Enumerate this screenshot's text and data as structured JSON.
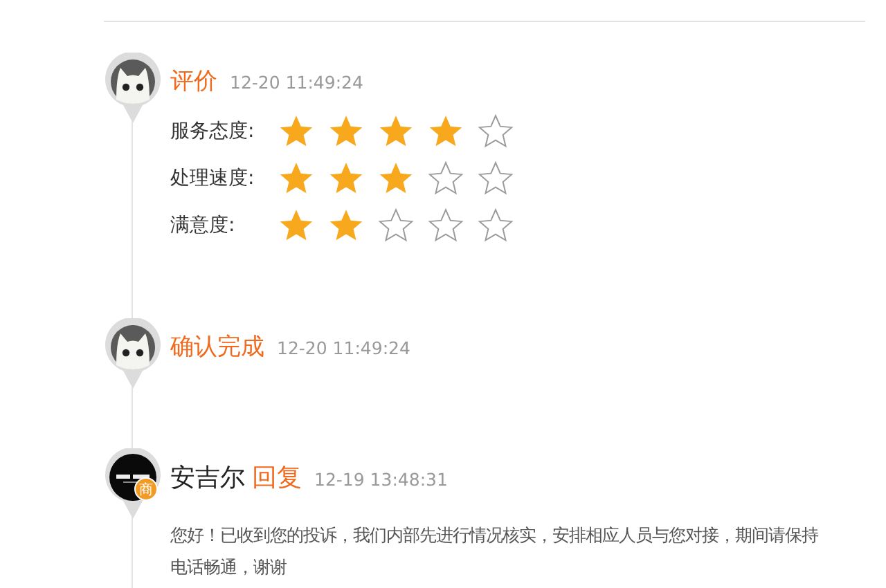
{
  "entries": [
    {
      "kind": "rating",
      "avatar": {
        "kind": "cat"
      },
      "title": "评价",
      "time": "12-20 11:49:24",
      "ratings": [
        {
          "label": "服务态度:",
          "stars": 4
        },
        {
          "label": "处理速度:",
          "stars": 3
        },
        {
          "label": "满意度:",
          "stars": 2
        }
      ]
    },
    {
      "kind": "status",
      "avatar": {
        "kind": "cat"
      },
      "title": "确认完成",
      "time": "12-20 11:49:24"
    },
    {
      "kind": "reply",
      "avatar": {
        "kind": "merchant"
      },
      "badge": "商",
      "name": "安吉尔",
      "title": "回复",
      "time": "12-19 13:48:31",
      "message": "您好！已收到您的投诉，我们内部先进行情况核实，安排相应人员与您对接，期间请保持电话畅通，谢谢"
    }
  ]
}
